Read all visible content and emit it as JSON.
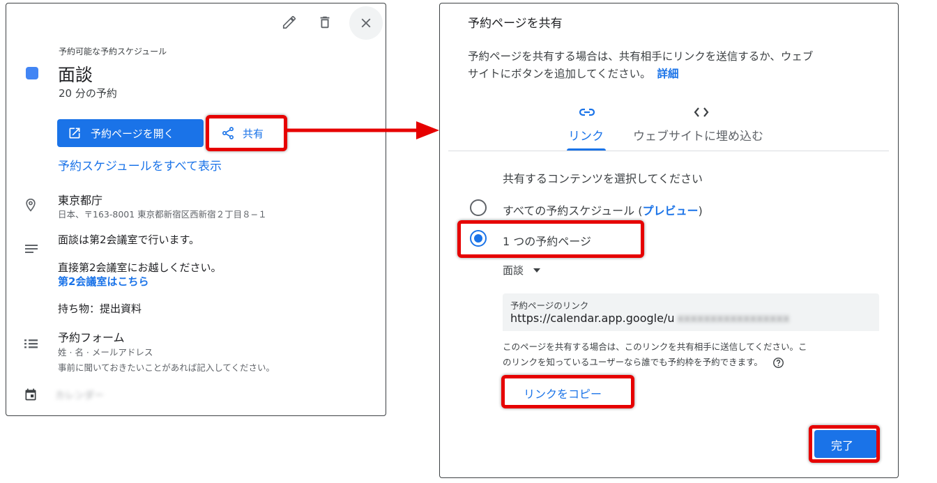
{
  "left": {
    "heading": "予約可能な予約スケジュール",
    "title": "面談",
    "duration": "20 分の予約",
    "open_page_label": "予約ページを開く",
    "share_label": "共有",
    "show_all_link": "予約スケジュールをすべて表示",
    "location_name": "東京都庁",
    "location_address": "日本、〒163-8001 東京都新宿区西新宿２丁目８−１",
    "description_line1": "面談は第2会議室で行います。",
    "description_line2": "直接第2会議室にお越しください。",
    "description_link": "第2会議室はこちら",
    "description_line3": "持ち物：提出資料",
    "form_title": "予約フォーム",
    "form_fields": "姓 · 名 · メールアドレス",
    "form_note": "事前に聞いておきたいことがあれば記入してください。",
    "calendar_name": "カレンダー"
  },
  "right": {
    "title": "予約ページを共有",
    "description_line1": "予約ページを共有する場合は、共有相手にリンクを送信するか、ウェブ",
    "description_line2": "サイトにボタンを追加してください。",
    "details_link": "詳細",
    "tab_link_label": "リンク",
    "tab_embed_label": "ウェブサイトに埋め込む",
    "select_prompt": "共有するコンテンツを選択してください",
    "option_all_prefix": "すべての予約スケジュール (",
    "option_all_link": "プレビュー",
    "option_all_suffix": ")",
    "option_one": "1 つの予約ページ",
    "dropdown_value": "面談",
    "link_field_label": "予約ページのリンク",
    "link_field_value": "https://calendar.app.google/u",
    "link_field_hidden": "xxxxxxxxxxxxxxxxx",
    "help_line1": "このページを共有する場合は、このリンクを共有相手に送信してください。こ",
    "help_line2": "のリンクを知っているユーザーなら誰でも予約枠を予約できます。",
    "copy_link_label": "リンクをコピー",
    "done_label": "完了"
  },
  "colors": {
    "accent": "#1a73e8",
    "highlight": "#e60000",
    "event_color": "#4285f4",
    "field_bg": "#f1f3f4"
  }
}
